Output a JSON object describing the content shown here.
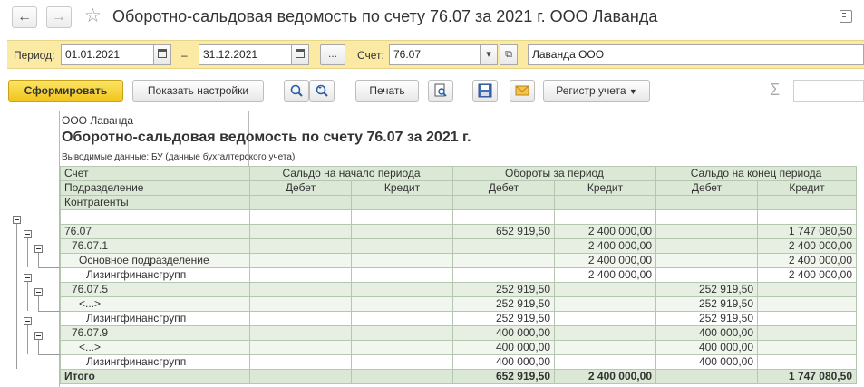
{
  "window": {
    "title": "Оборотно-сальдовая ведомость по счету 76.07 за 2021 г. ООО Лаванда",
    "back_icon": "arrow-left-icon",
    "forward_icon": "arrow-right-icon",
    "favorite_icon": "star-icon",
    "more_icon": "more-menu-icon"
  },
  "params": {
    "period_label": "Период:",
    "date_from": "01.01.2021",
    "dash": "–",
    "date_to": "31.12.2021",
    "ellipsis": "...",
    "account_label": "Счет:",
    "account_value": "76.07",
    "org_value": "Лаванда ООО"
  },
  "toolbar": {
    "generate": "Сформировать",
    "show_settings": "Показать настройки",
    "print": "Печать",
    "register": "Регистр учета",
    "sigma": "Σ"
  },
  "report": {
    "org": "ООО Лаванда",
    "title": "Оборотно-сальдовая ведомость по счету 76.07 за 2021 г.",
    "shown_data": "Выводимые данные:  БУ (данные бухгалтерского учета)",
    "headers": {
      "account": "Счет",
      "subdivision": "Подразделение",
      "counterparties": "Контрагенты",
      "opening": "Сальдо на начало периода",
      "turnover": "Обороты за период",
      "closing": "Сальдо на конец периода",
      "debit": "Дебет",
      "credit": "Кредит"
    },
    "rows": [
      {
        "name": "76.07",
        "od": "",
        "oc": "",
        "td": "652 919,50",
        "tc": "2 400 000,00",
        "cd": "",
        "cc": "1 747 080,50"
      },
      {
        "name": "76.07.1",
        "od": "",
        "oc": "",
        "td": "",
        "tc": "2 400 000,00",
        "cd": "",
        "cc": "2 400 000,00"
      },
      {
        "name": "Основное подразделение",
        "od": "",
        "oc": "",
        "td": "",
        "tc": "2 400 000,00",
        "cd": "",
        "cc": "2 400 000,00"
      },
      {
        "name": "Лизингфинансгрупп",
        "od": "",
        "oc": "",
        "td": "",
        "tc": "2 400 000,00",
        "cd": "",
        "cc": "2 400 000,00"
      },
      {
        "name": "76.07.5",
        "od": "",
        "oc": "",
        "td": "252 919,50",
        "tc": "",
        "cd": "252 919,50",
        "cc": ""
      },
      {
        "name": "<...>",
        "od": "",
        "oc": "",
        "td": "252 919,50",
        "tc": "",
        "cd": "252 919,50",
        "cc": ""
      },
      {
        "name": "Лизингфинансгрупп",
        "od": "",
        "oc": "",
        "td": "252 919,50",
        "tc": "",
        "cd": "252 919,50",
        "cc": ""
      },
      {
        "name": "76.07.9",
        "od": "",
        "oc": "",
        "td": "400 000,00",
        "tc": "",
        "cd": "400 000,00",
        "cc": ""
      },
      {
        "name": "<...>",
        "od": "",
        "oc": "",
        "td": "400 000,00",
        "tc": "",
        "cd": "400 000,00",
        "cc": ""
      },
      {
        "name": "Лизингфинансгрупп",
        "od": "",
        "oc": "",
        "td": "400 000,00",
        "tc": "",
        "cd": "400 000,00",
        "cc": ""
      }
    ],
    "total": {
      "name": "Итого",
      "od": "",
      "oc": "",
      "td": "652 919,50",
      "tc": "2 400 000,00",
      "cd": "",
      "cc": "1 747 080,50"
    }
  }
}
